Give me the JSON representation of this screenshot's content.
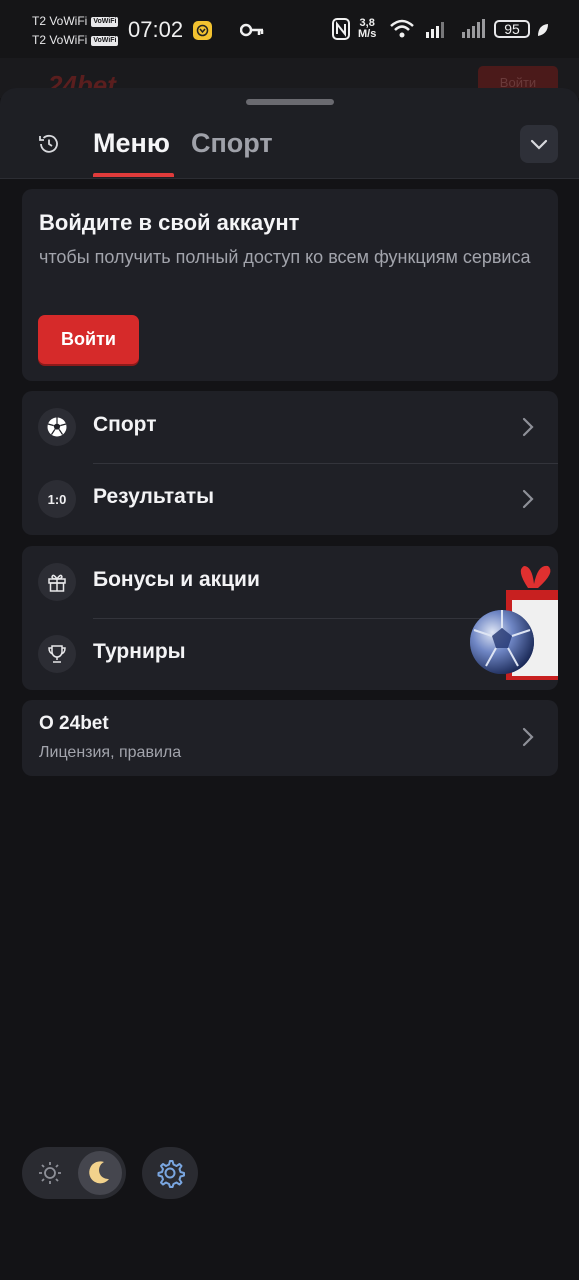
{
  "statusbar": {
    "carrier1": "T2 VoWiFi",
    "carrier2": "T2 VoWiFi",
    "vowifi_badge": "VoWiFi",
    "time": "07:02",
    "speed_value": "3,8",
    "speed_unit": "M/s",
    "battery": "95"
  },
  "background": {
    "logo": "24bet",
    "login_label": "Войти"
  },
  "sheet": {
    "tabs": [
      {
        "label": "Меню",
        "active": true
      },
      {
        "label": "Спорт",
        "active": false
      }
    ]
  },
  "login_card": {
    "title": "Войдите в свой аккаунт",
    "subtitle": "чтобы получить полный доступ ко всем функциям сервиса",
    "button": "Войти"
  },
  "menu_group_1": [
    {
      "label": "Спорт",
      "icon": "soccer-ball-icon"
    },
    {
      "label": "Результаты",
      "icon_text": "1:0"
    }
  ],
  "menu_group_2": [
    {
      "label": "Бонусы и акции",
      "icon": "gift-icon"
    },
    {
      "label": "Турниры",
      "icon": "trophy-icon"
    }
  ],
  "about": {
    "title": "О 24bet",
    "subtitle": "Лицензия, правила"
  },
  "colors": {
    "accent": "#d62a2a",
    "background": "#131316",
    "card": "#1f2026"
  }
}
